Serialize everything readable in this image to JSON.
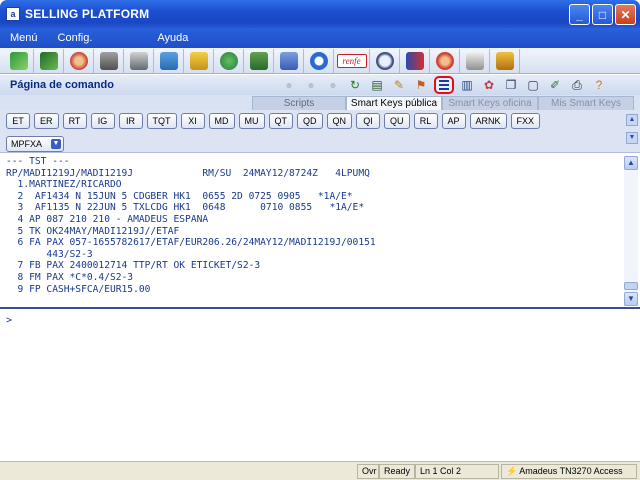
{
  "window": {
    "title": "SELLING PLATFORM",
    "app_icon": "a"
  },
  "menubar": {
    "items": [
      "Menú",
      "Config.",
      "Ayuda"
    ]
  },
  "iconbar": {
    "icons": [
      "book-icon",
      "monitor-icon",
      "person-icon",
      "car-icon",
      "train-icon",
      "ship-icon",
      "hotel-icon",
      "globe-icon",
      "calculator-icon",
      "document-icon",
      "info-icon",
      "renfe-logo",
      "search-icon",
      "tower-icon",
      "agent-icon",
      "ticket-icon",
      "cart-icon"
    ],
    "renfe_text": "renfe"
  },
  "cmdbar": {
    "label": "Página de comando",
    "icons": [
      "back-icon",
      "forward-icon",
      "stop-icon",
      "refresh-icon",
      "notes-icon",
      "pencil-icon",
      "flag-icon",
      "smartkeys-icon",
      "columns-icon",
      "palette-icon",
      "copy-icon",
      "paste-icon",
      "edit-icon",
      "print-icon",
      "help-icon"
    ]
  },
  "tabs": [
    "Scripts",
    "Smart Keys pública",
    "Smart Keys oficina",
    "Mis Smart Keys"
  ],
  "smart_keys": [
    "ET",
    "ER",
    "RT",
    "IG",
    "IR",
    "TQT",
    "XI",
    "MD",
    "MU",
    "QT",
    "QD",
    "QN",
    "QI",
    "QU",
    "RL",
    "AP",
    "ARNK",
    "FXX"
  ],
  "dropdown": {
    "value": "MPFXA"
  },
  "terminal": {
    "lines": [
      "--- TST ---",
      "RP/MADI1219J/MADI1219J            RM/SU  24MAY12/8724Z   4LPUMQ",
      "  1.MARTINEZ/RICARDO",
      "  2  AF1434 N 15JUN 5 CDGBER HK1  0655 2D 0725 0905   *1A/E*",
      "  3  AF1135 N 22JUN 5 TXLCDG HK1  0648      0710 0855   *1A/E*",
      "  4 AP 087 210 210 - AMADEUS ESPANA",
      "  5 TK OK24MAY/MADI1219J//ETAF",
      "  6 FA PAX 057-1655782617/ETAF/EUR206.26/24MAY12/MADI1219J/00151",
      "       443/S2-3",
      "  7 FB PAX 2400012714 TTP/RT OK ETICKET/S2-3",
      "  8 FM PAX *C*0.4/S2-3",
      "  9 FP CASH+SFCA/EUR15.00"
    ]
  },
  "input": {
    "prompt": ">"
  },
  "statusbar": {
    "ovr": "Ovr",
    "state": "Ready",
    "position": "Ln 1 Col 2",
    "connection": "Amadeus TN3270 Access"
  },
  "colors": {
    "titlebar": "#1c4fd0",
    "terminal_text": "#1a3a8c",
    "highlight": "#e01010"
  }
}
